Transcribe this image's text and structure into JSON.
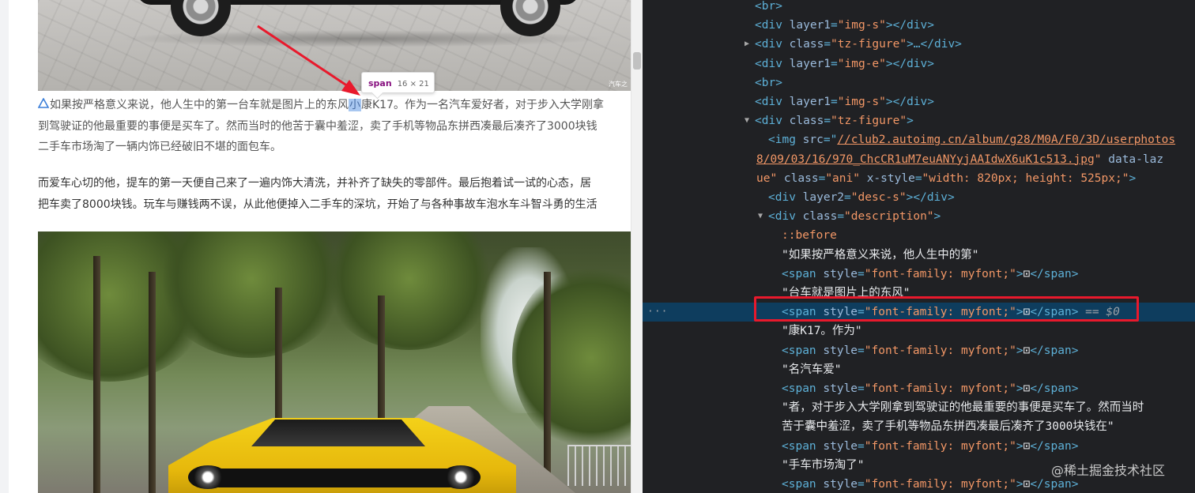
{
  "article": {
    "top_image_watermark": "汽车之",
    "para1": {
      "line1_before": "如果按严格意义来说，他人生中的第一台车就是图片上的东风",
      "line1_highlight": "小",
      "line1_after": "康K17。作为一名汽车爱好者，对于步入大学刚拿",
      "line2": "到驾驶证的他最重要的事便是买车了。然而当时的他苦于囊中羞涩，卖了手机等物品东拼西凑最后凑齐了3000块钱",
      "line3": "二手车市场淘了一辆内饰已经破旧不堪的面包车。"
    },
    "para2": {
      "line1": "而爱车心切的他，提车的第一天便自己来了一遍内饰大清洗，并补齐了缺失的零部件。最后抱着试一试的心态，居",
      "line2": "把车卖了8000块钱。玩车与赚钱两不误，从此他便掉入二手车的深坑，开始了与各种事故车泡水车斗智斗勇的生活"
    }
  },
  "inspect_tooltip": {
    "tag": "span",
    "size": "16 × 21"
  },
  "devtools": {
    "lines": [
      {
        "indent": 955,
        "kind": "br",
        "text": "<br>"
      },
      {
        "indent": 955,
        "kind": "div-attr",
        "open": "<div ",
        "attr": "layer1",
        "eq": "=",
        "val": "\"img-s\"",
        "close": "></div>"
      },
      {
        "indent": 955,
        "kind": "div-attr",
        "arrow": "collapsed",
        "open": "<div ",
        "attr": "class",
        "eq": "=",
        "val": "\"tz-figure\"",
        "close": ">…</div>"
      },
      {
        "indent": 955,
        "kind": "div-attr",
        "open": "<div ",
        "attr": "layer1",
        "eq": "=",
        "val": "\"img-e\"",
        "close": "></div>"
      },
      {
        "indent": 955,
        "kind": "br",
        "text": "<br>"
      },
      {
        "indent": 955,
        "kind": "div-attr",
        "open": "<div ",
        "attr": "layer1",
        "eq": "=",
        "val": "\"img-s\"",
        "close": "></div>"
      },
      {
        "indent": 955,
        "kind": "div-attr",
        "arrow": "expanded",
        "open": "<div ",
        "attr": "class",
        "eq": "=",
        "val": "\"tz-figure\"",
        "close": ">"
      },
      {
        "indent": 972,
        "kind": "img"
      },
      {
        "indent": 957,
        "kind": "img2"
      },
      {
        "indent": 972,
        "kind": "img3"
      },
      {
        "indent": 972,
        "kind": "div-attr",
        "open": "<div ",
        "attr": "layer2",
        "eq": "=",
        "val": "\"desc-s\"",
        "close": "></div>"
      },
      {
        "indent": 972,
        "kind": "div-attr",
        "arrow": "expanded",
        "open": "<div ",
        "attr": "class",
        "eq": "=",
        "val": "\"description\"",
        "close": ">"
      },
      {
        "indent": 989,
        "kind": "pseudo",
        "text": "::before"
      },
      {
        "indent": 989,
        "kind": "str",
        "text": "\"如果按严格意义来说，他人生中的第\""
      },
      {
        "indent": 989,
        "kind": "span"
      },
      {
        "indent": 989,
        "kind": "str",
        "text": "\"台车就是图片上的东风\""
      },
      {
        "indent": 989,
        "kind": "span",
        "selected": true
      },
      {
        "indent": 989,
        "kind": "str",
        "text": "\"康K17。作为\""
      },
      {
        "indent": 989,
        "kind": "span"
      },
      {
        "indent": 989,
        "kind": "str",
        "text": "\"名汽车爱\""
      },
      {
        "indent": 989,
        "kind": "span"
      },
      {
        "indent": 989,
        "kind": "str",
        "text": "\"者，对于步入大学刚拿到驾驶证的他最重要的事便是买车了。然而当时"
      },
      {
        "indent": 989,
        "kind": "str",
        "text": "苦于囊中羞涩，卖了手机等物品东拼西凑最后凑齐了3000块钱在\""
      },
      {
        "indent": 989,
        "kind": "span"
      },
      {
        "indent": 989,
        "kind": "str",
        "text": "\"手车市场淘了\""
      },
      {
        "indent": 989,
        "kind": "span"
      }
    ],
    "img": {
      "open": "<img ",
      "src_attr": "src",
      "eq": "=\"",
      "src_line1": "//club2.autoimg.cn/album/g28/M0A/F0/3D/userphotos",
      "src_line2": "8/09/03/16/970_ChcCR1uM7euANYyjAAIdwX6uK1c513.jpg",
      "after_src": "\" ",
      "lazy_attr": "data-laz",
      "lazy_val_end": "ue\"",
      "class_attr": "class",
      "class_val": "\"ani\"",
      "style_attr": "x-style",
      "style_val": "\"width: 820px; height: 525px;\"",
      "close": ">"
    },
    "span": {
      "open": "<span ",
      "attr": "style",
      "eq": "=",
      "val": "\"font-family: myfont;\"",
      "gt": ">",
      "glyph": "⊡",
      "close": "</span>"
    },
    "selected_suffix": {
      "eq": " == ",
      "dollar": "$0"
    },
    "selected_dots": "···",
    "watermark": "@稀土掘金技术社区"
  },
  "colors": {
    "selected_row": "#0e3d5e",
    "tag": "#5db0d7",
    "attr": "#9bbbdc",
    "value": "#f29766",
    "annotation": "#e8192c"
  }
}
